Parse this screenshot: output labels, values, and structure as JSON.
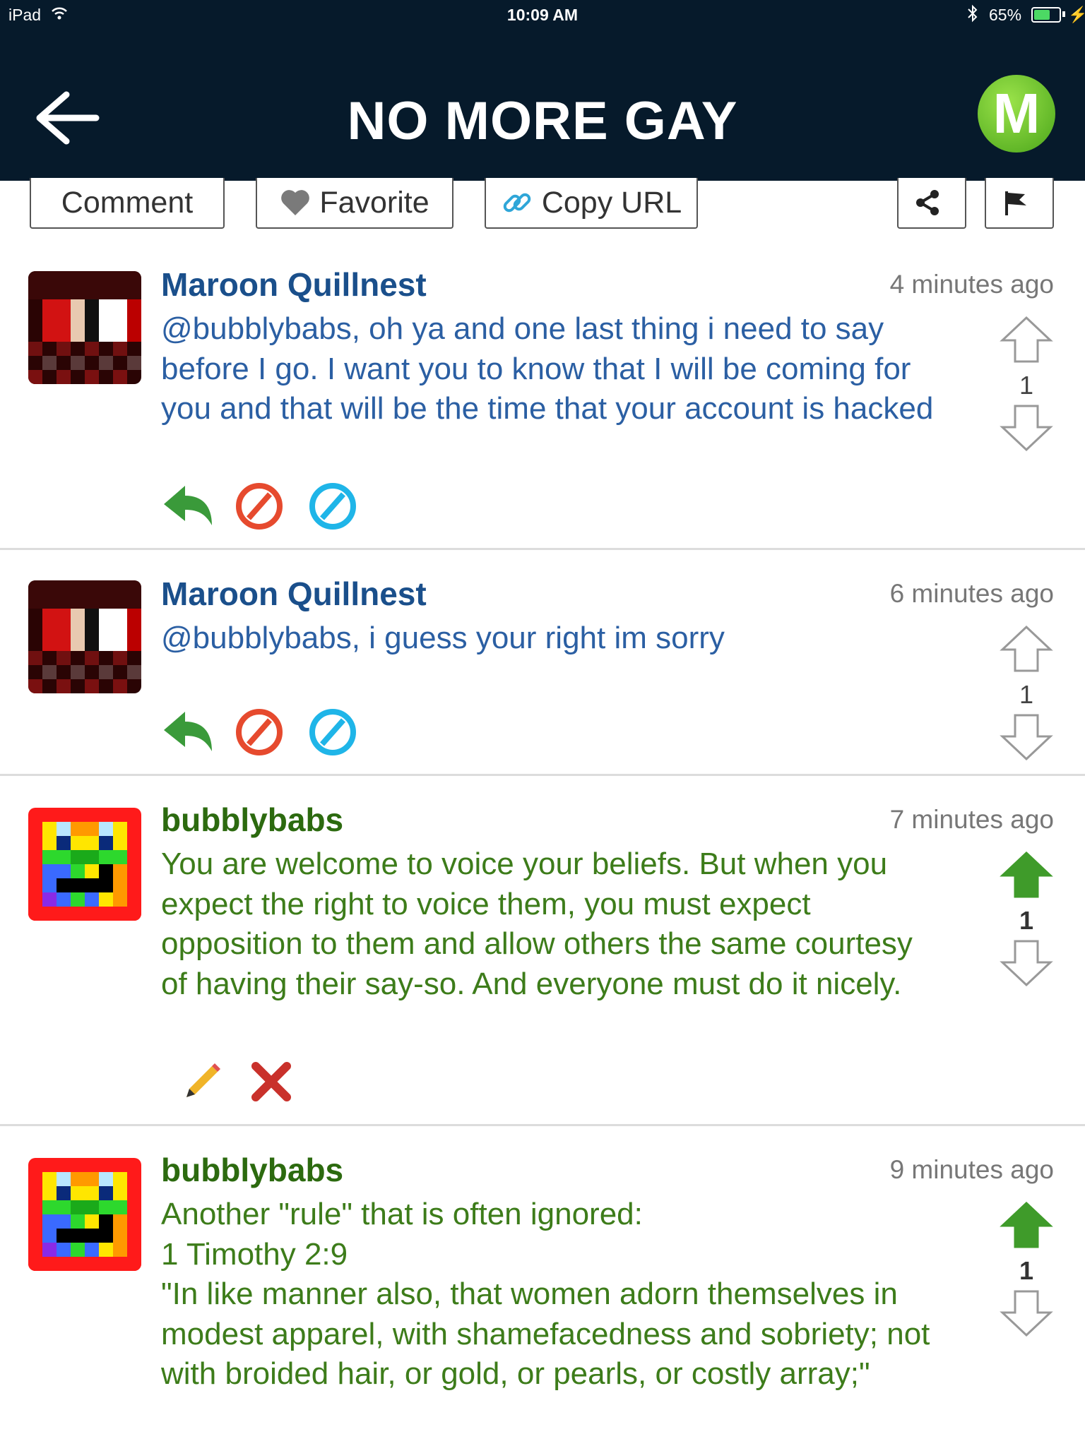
{
  "status_bar": {
    "device": "iPad",
    "time": "10:09 AM",
    "battery_percent": "65%",
    "battery_level": 0.65
  },
  "header": {
    "title": "NO MORE GAY",
    "logo_letter": "M",
    "back_icon": "back-arrow-icon"
  },
  "actions_bar": {
    "comment_label": "Comment",
    "favorite_label": "Favorite",
    "copy_url_label": "Copy URL",
    "share_icon": "share-icon",
    "flag_icon": "flag-icon"
  },
  "colors": {
    "header_bg": "#061a2b",
    "other_user": "#1a4f8b",
    "own_user": "#2c6a0f",
    "upvote_active": "#3f9b2a"
  },
  "comments": [
    {
      "author": "Maroon Quillnest",
      "time": "4 minutes ago",
      "text": "@bubblybabs, oh ya and one last thing i need to say before I go. I want you to know that I will be coming for you and that will be the time that your account is hacked",
      "votes": "1",
      "actions": [
        "reply-icon",
        "block-icon",
        "ignore-icon"
      ]
    },
    {
      "author": "Maroon Quillnest",
      "time": "6 minutes ago",
      "text": "@bubblybabs, i guess your right im sorry",
      "votes": "1",
      "actions": [
        "reply-icon",
        "block-icon",
        "ignore-icon"
      ]
    },
    {
      "author": "bubblybabs",
      "time": "7 minutes ago",
      "text": "You are welcome to voice your beliefs. But when you expect the right to voice them, you must expect opposition to them and allow others the same courtesy of having their say-so. And everyone must do it nicely.",
      "votes": "1",
      "actions": [
        "edit-pencil-icon",
        "delete-icon"
      ]
    },
    {
      "author": "bubblybabs",
      "time": "9 minutes ago",
      "text": "Another \"rule\" that is often ignored:\n1 Timothy 2:9\n\"In like manner also, that women adorn themselves in modest apparel, with shamefacedness and sobriety; not with broided hair, or gold, or pearls, or costly array;\"",
      "votes": "1"
    }
  ]
}
